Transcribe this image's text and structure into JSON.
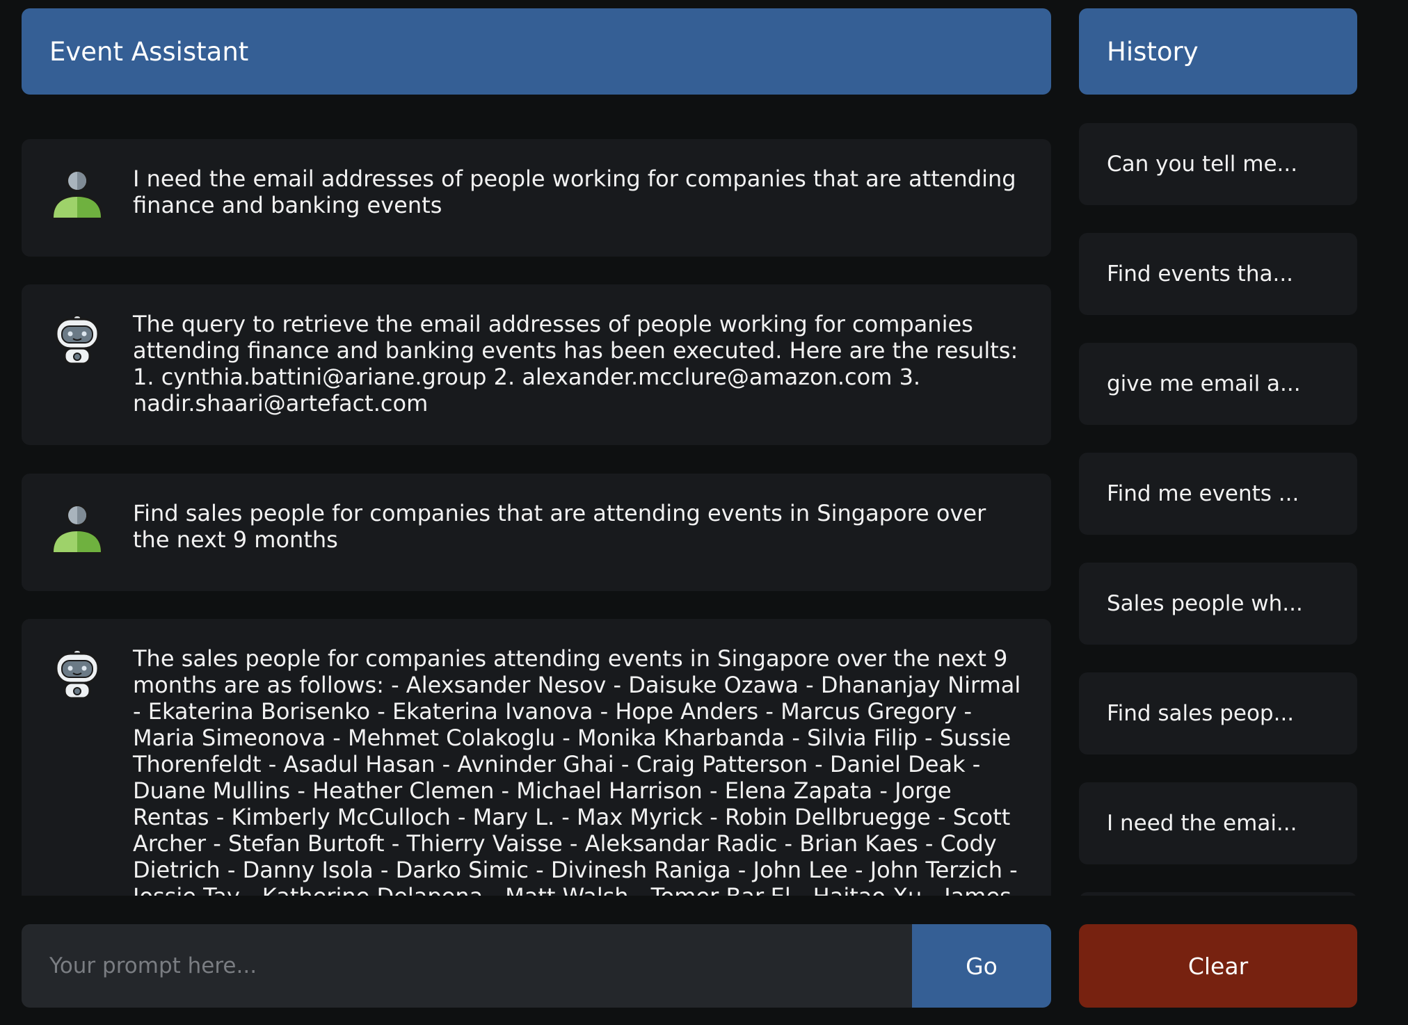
{
  "header": {
    "title": "Event Assistant"
  },
  "messages": [
    {
      "role": "user",
      "avatar_icon": "user-icon",
      "text": "I need the email addresses of people working for companies that are attending finance and banking events"
    },
    {
      "role": "assistant",
      "avatar_icon": "robot-icon",
      "text": "The query to retrieve the email addresses of people working for companies attending finance and banking events has been executed. Here are the results: 1. cynthia.battini@ariane.group 2. alexander.mcclure@amazon.com 3. nadir.shaari@artefact.com"
    },
    {
      "role": "user",
      "avatar_icon": "user-icon",
      "text": "Find sales people for companies that are attending events in Singapore over the next 9 months"
    },
    {
      "role": "assistant",
      "avatar_icon": "robot-icon",
      "text": "The sales people for companies attending events in Singapore over the next 9 months are as follows: - Alexsander Nesov - Daisuke Ozawa - Dhananjay Nirmal - Ekaterina Borisenko - Ekaterina Ivanova - Hope Anders - Marcus Gregory - Maria Simeonova - Mehmet Colakoglu - Monika Kharbanda - Silvia Filip - Sussie Thorenfeldt - Asadul Hasan - Avninder Ghai - Craig Patterson - Daniel Deak - Duane Mullins - Heather Clemen - Michael Harrison - Elena Zapata - Jorge Rentas - Kimberly McCulloch - Mary L. - Max Myrick - Robin Dellbruegge - Scott Archer - Stefan Burtoft - Thierry Vaisse - Aleksandar Radic - Brian Kaes - Cody Dietrich - Danny Isola - Darko Simic - Divinesh Raniga - John Lee - John Terzich - Jossie Tay - Katherine Delapena - Matt Walsh - Tomer Bar-El - Haitao Xu - James Gaither"
    }
  ],
  "history": {
    "title": "History",
    "items": [
      "Can you tell me...",
      "Find events tha...",
      "give me email a...",
      "Find me events ...",
      "Sales people wh...",
      "Find sales peop...",
      "I need the emai..."
    ]
  },
  "prompt": {
    "placeholder": "Your prompt here...",
    "value": ""
  },
  "buttons": {
    "go_label": "Go",
    "clear_label": "Clear"
  },
  "colors": {
    "background": "#0e1011",
    "header": "#355f95",
    "card": "#181a1d",
    "input": "#24272b",
    "go_button": "#355f95",
    "clear_button": "#772210",
    "user_avatar_green": "#8fd14f"
  }
}
